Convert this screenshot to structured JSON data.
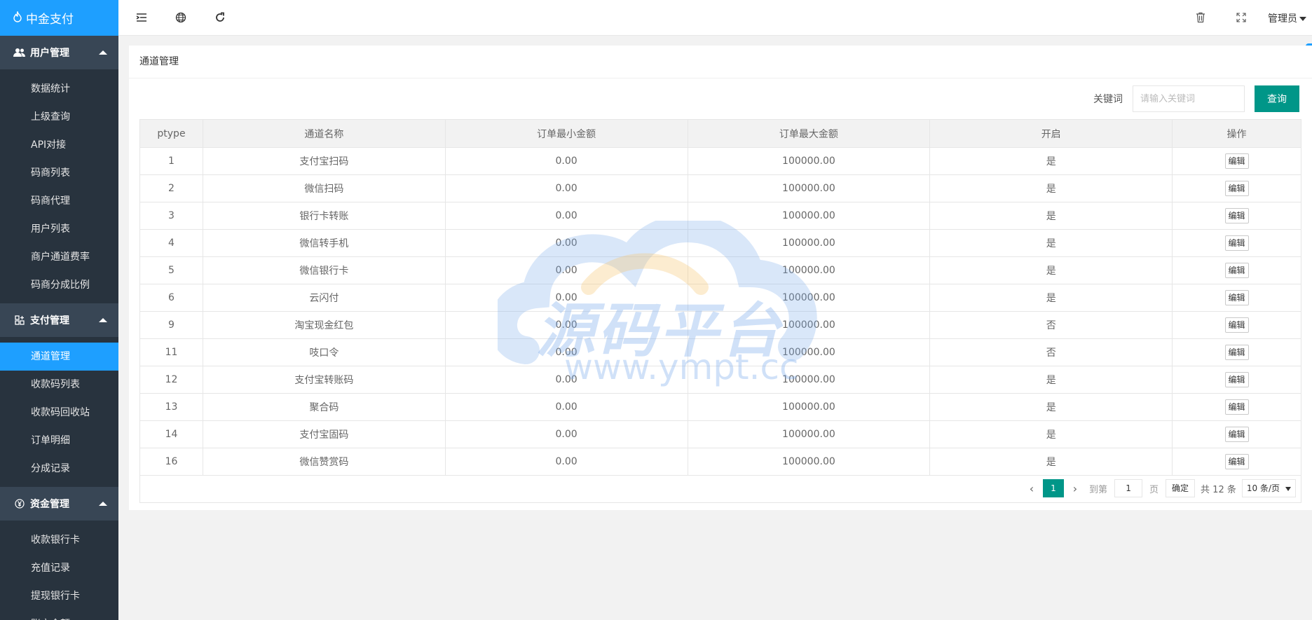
{
  "brand": {
    "name": "中金支付"
  },
  "sidebar": {
    "groups": [
      {
        "title": "用户管理",
        "items": [
          "数据统计",
          "上级查询",
          "API对接",
          "码商列表",
          "码商代理",
          "用户列表",
          "商户通道费率",
          "码商分成比例"
        ]
      },
      {
        "title": "支付管理",
        "items": [
          "通道管理",
          "收款码列表",
          "收款码回收站",
          "订单明细",
          "分成记录"
        ]
      },
      {
        "title": "资金管理",
        "items": [
          "收款银行卡",
          "充值记录",
          "提现银行卡",
          "账户余额"
        ]
      }
    ],
    "active_item": "通道管理"
  },
  "header": {
    "user_label": "管理员"
  },
  "page": {
    "title": "通道管理",
    "search": {
      "label": "关键词",
      "placeholder": "请输入关键词",
      "button": "查询"
    }
  },
  "table": {
    "columns": [
      "ptype",
      "通道名称",
      "订单最小金额",
      "订单最大金额",
      "开启",
      "操作"
    ],
    "edit_label": "编辑",
    "rows": [
      [
        "1",
        "支付宝扫码",
        "0.00",
        "100000.00",
        "是"
      ],
      [
        "2",
        "微信扫码",
        "0.00",
        "100000.00",
        "是"
      ],
      [
        "3",
        "银行卡转账",
        "0.00",
        "100000.00",
        "是"
      ],
      [
        "4",
        "微信转手机",
        "0.00",
        "100000.00",
        "是"
      ],
      [
        "5",
        "微信银行卡",
        "0.00",
        "100000.00",
        "是"
      ],
      [
        "6",
        "云闪付",
        "0.00",
        "100000.00",
        "是"
      ],
      [
        "9",
        "淘宝现金红包",
        "0.00",
        "100000.00",
        "否"
      ],
      [
        "11",
        "吱口令",
        "0.00",
        "100000.00",
        "否"
      ],
      [
        "12",
        "支付宝转账码",
        "0.00",
        "100000.00",
        "是"
      ],
      [
        "13",
        "聚合码",
        "0.00",
        "100000.00",
        "是"
      ],
      [
        "14",
        "支付宝固码",
        "0.00",
        "100000.00",
        "是"
      ],
      [
        "16",
        "微信赞赏码",
        "0.00",
        "100000.00",
        "是"
      ]
    ]
  },
  "pagination": {
    "current": "1",
    "goto_label": "到第",
    "goto_value": "1",
    "page_unit": "页",
    "confirm": "确定",
    "total": "共 12 条",
    "page_size": "10 条/页"
  },
  "watermark": {
    "text": "源码平台",
    "url": "www.ympt.cc"
  },
  "colors": {
    "primary": "#1e9fff",
    "sidebar": "#28333e",
    "accent": "#009688"
  }
}
